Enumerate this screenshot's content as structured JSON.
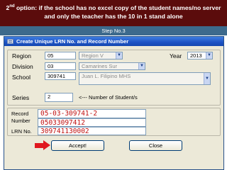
{
  "banner": {
    "ordinal": "2",
    "ordinal_sup": "nd",
    "line1_rest": " option:  if the school has no excel copy of the student names/no server",
    "line2": "and only the teacher has the 10 in 1 stand alone"
  },
  "step_label": "Step No.3",
  "window": {
    "title": "Create Unique LRN No. and Record Number"
  },
  "form": {
    "region_label": "Region",
    "region_code": "05",
    "region_name": "Region V",
    "year_label": "Year",
    "year_value": "2013",
    "division_label": "Division",
    "division_code": "03",
    "division_name": "Camarines Sur",
    "school_label": "School",
    "school_code": "309741",
    "school_name": "Juan L. Filipino MHS",
    "series_label": "Series",
    "series_value": "2",
    "series_hint": "<---  Number of Student/s"
  },
  "output": {
    "record_number_label_1": "Record",
    "record_number_label_2": "Number",
    "record_number_value_1": "05-03-309741-2",
    "record_number_value_2": "05033097412",
    "lrn_label": "LRN No.",
    "lrn_value": "309741130002"
  },
  "buttons": {
    "accept": "Accept!",
    "close": "Close"
  },
  "colors": {
    "banner_bg": "#5b0c0c",
    "step_bg": "#3d6a8c",
    "value_text": "#c01010",
    "arrow": "#e0181e"
  }
}
